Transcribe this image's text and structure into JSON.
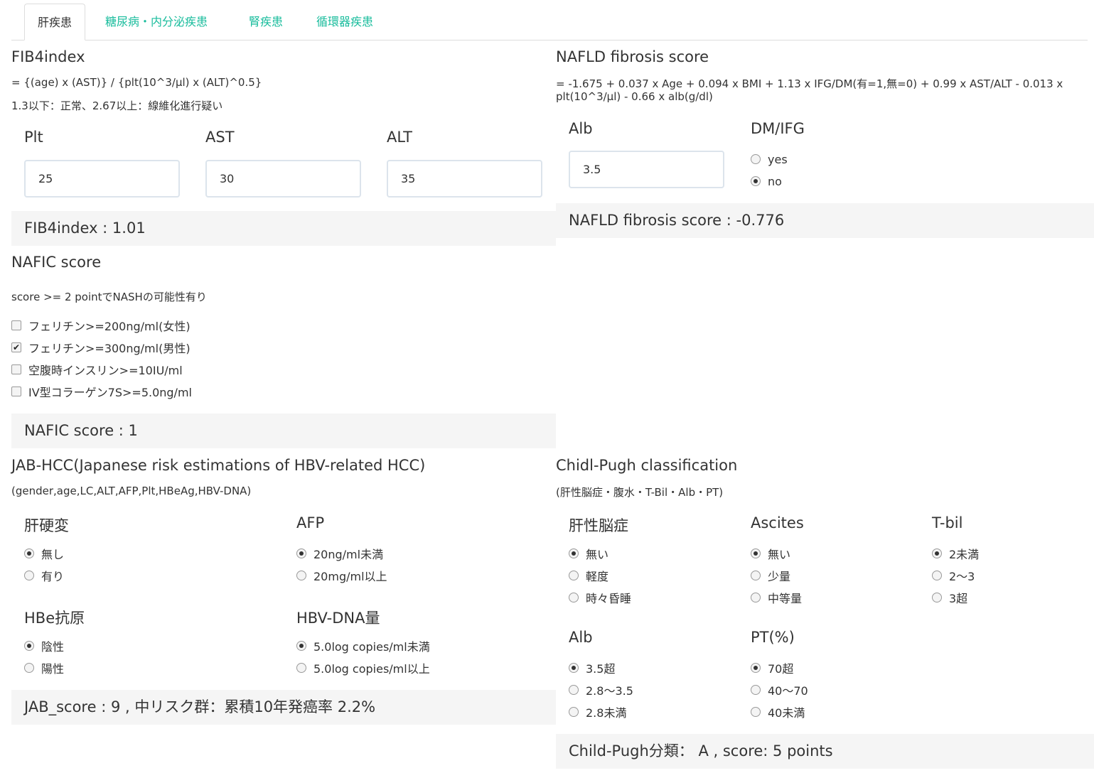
{
  "tabs": [
    "肝疾患",
    "糖尿病・内分泌疾患",
    "腎疾患",
    "循環器疾患"
  ],
  "fib4": {
    "title": "FIB4index",
    "formula": "= {(age) x (AST)} / {plt(10^3/μl) x (ALT)^0.5}",
    "note": "1.3以下：正常、2.67以上：線維化進行疑い",
    "plt_label": "Plt",
    "ast_label": "AST",
    "alt_label": "ALT",
    "plt_value": "25",
    "ast_value": "30",
    "alt_value": "35",
    "result": "FIB4index : 1.01"
  },
  "nafld": {
    "title": "NAFLD fibrosis score",
    "formula_line1": "= -1.675 + 0.037 x Age + 0.094 x BMI + 1.13 x IFG/DM(有=1,無=0) + 0.99 x AST/ALT - 0.013 x",
    "formula_line2": "plt(10^3/μl) - 0.66 x alb(g/dl)",
    "alb_label": "Alb",
    "alb_value": "3.5",
    "dm_label": "DM/IFG",
    "dm_options": [
      "yes",
      "no"
    ],
    "dm_selected": "no",
    "result": "NAFLD fibrosis score : -0.776"
  },
  "nafic": {
    "title": "NAFIC score",
    "note": "score >= 2 pointでNASHの可能性有り",
    "items": [
      "フェリチン>=200ng/ml(女性)",
      "フェリチン>=300ng/ml(男性)",
      "空腹時インスリン>=10IU/ml",
      "IV型コラーゲン7S>=5.0ng/ml"
    ],
    "checked": [
      false,
      true,
      false,
      false
    ],
    "check_glyph": "✔",
    "result": "NAFIC score : 1"
  },
  "jab": {
    "title": "JAB-HCC(Japanese risk estimations of HBV-related HCC)",
    "sub": "(gender,age,LC,ALT,AFP,Plt,HBeAg,HBV-DNA)",
    "lc_label": "肝硬変",
    "lc_options": [
      "無し",
      "有り"
    ],
    "afp_label": "AFP",
    "afp_options": [
      "20ng/ml未満",
      "20mg/ml以上"
    ],
    "hbe_label": "HBe抗原",
    "hbe_options": [
      "陰性",
      "陽性"
    ],
    "dna_label": "HBV-DNA量",
    "dna_options": [
      "5.0log copies/ml未満",
      "5.0log copies/ml以上"
    ],
    "result": "JAB_score : 9 , 中リスク群：累積10年発癌率 2.2%"
  },
  "childpugh": {
    "title": "Chidl-Pugh classification",
    "sub": "(肝性脳症・腹水・T-Bil・Alb・PT)",
    "enc_label": "肝性脳症",
    "enc_options": [
      "無い",
      "軽度",
      "時々昏睡"
    ],
    "asc_label": "Ascites",
    "asc_options": [
      "無い",
      "少量",
      "中等量"
    ],
    "tbil_label": "T-bil",
    "tbil_options": [
      "2未満",
      "2～3",
      "3超"
    ],
    "alb_label": "Alb",
    "alb_options": [
      "3.5超",
      "2.8～3.5",
      "2.8未満"
    ],
    "pt_label": "PT(%)",
    "pt_options": [
      "70超",
      "40～70",
      "40未満"
    ],
    "result": "Child-Pugh分類： A , score: 5 points"
  },
  "colors": {
    "accent": "#18bc9c",
    "text": "#333333",
    "well": "#f5f5f5",
    "input_border": "#dce4ec"
  }
}
